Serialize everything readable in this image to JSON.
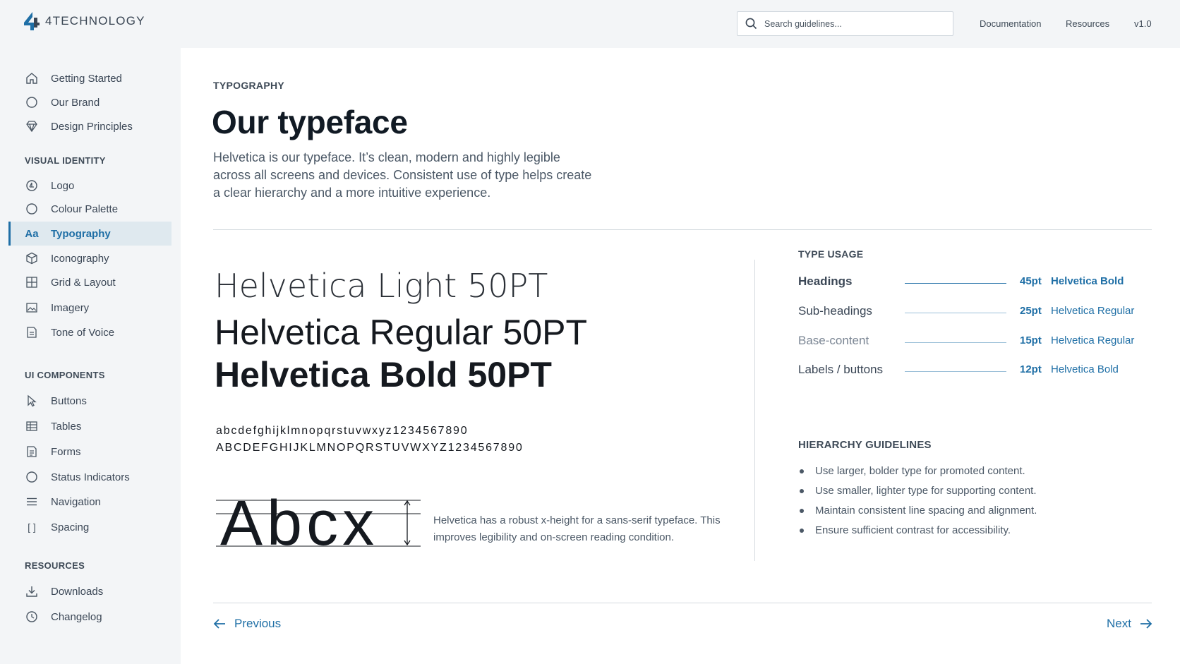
{
  "brand": {
    "name": "4TECHNOLOGY",
    "accent": "#1f6fa6"
  },
  "search": {
    "placeholder": "Search guidelines..."
  },
  "topnav": {
    "documentation": "Documentation",
    "resources": "Resources",
    "version": "v1.0"
  },
  "sidebar": {
    "top_items": [
      {
        "label": "Getting Started",
        "icon": "home-icon"
      },
      {
        "label": "Our Brand",
        "icon": "circle-icon"
      },
      {
        "label": "Design Principles",
        "icon": "diamond-icon"
      }
    ],
    "visual_identity": {
      "heading": "VISUAL IDENTITY",
      "items": [
        {
          "label": "Logo",
          "icon": "logo-icon"
        },
        {
          "label": "Colour Palette",
          "icon": "circle-icon"
        },
        {
          "label": "Typography",
          "icon": "type-aa-icon",
          "icon_text": "Aa",
          "active": true
        },
        {
          "label": "Iconography",
          "icon": "cube-icon"
        },
        {
          "label": "Grid & Layout",
          "icon": "grid-icon"
        },
        {
          "label": "Imagery",
          "icon": "image-icon"
        },
        {
          "label": "Tone of Voice",
          "icon": "document-icon"
        }
      ]
    },
    "ui_components": {
      "heading": "UI COMPONENTS",
      "items": [
        {
          "label": "Buttons",
          "icon": "cursor-icon"
        },
        {
          "label": "Tables",
          "icon": "table-icon"
        },
        {
          "label": "Forms",
          "icon": "form-icon"
        },
        {
          "label": "Status Indicators",
          "icon": "circle-icon"
        },
        {
          "label": "Navigation",
          "icon": "menu-icon"
        },
        {
          "label": "Spacing",
          "icon": "brackets-icon",
          "icon_text": "[ ]"
        }
      ]
    },
    "resources": {
      "heading": "RESOURCES",
      "items": [
        {
          "label": "Downloads",
          "icon": "download-icon"
        },
        {
          "label": "Changelog",
          "icon": "clock-icon"
        }
      ]
    }
  },
  "main": {
    "eyebrow": "TYPOGRAPHY",
    "title": "Our typeface",
    "intro": "Helvetica is our typeface. It’s clean, modern and highly legible across all screens and devices. Consistent use of type helps create a clear hierarchy and a more intuitive experience.",
    "samples": {
      "light": "Helvetica Light 50PT",
      "regular": "Helvetica Regular 50PT",
      "bold": "Helvetica Bold 50PT"
    },
    "lowercase": "abcdefghijklmnopqrstuvwxyz1234567890",
    "uppercase": "ABCDEFGHIJKLMNOPQRSTUVWXYZ1234567890",
    "xheight_sample": "Abcx",
    "xheight_note": "Helvetica has a robust x-height for a sans-serif typeface. This improves legibility and on-screen reading condition.",
    "type_usage": {
      "heading": "TYPE USAGE",
      "rows": [
        {
          "name": "Headings",
          "size": "45pt",
          "font": "Helvetica Bold"
        },
        {
          "name": "Sub-headings",
          "size": "25pt",
          "font": "Helvetica Regular"
        },
        {
          "name": "Base-content",
          "size": "15pt",
          "font": "Helvetica Regular"
        },
        {
          "name": "Labels / buttons",
          "size": "12pt",
          "font": "Helvetica Bold"
        }
      ]
    },
    "hierarchy": {
      "heading": "HIERARCHY GUIDELINES",
      "items": [
        "Use larger, bolder type for promoted content.",
        "Use smaller, lighter type for supporting content.",
        "Maintain consistent line spacing and alignment.",
        "Ensure sufficient contrast for accessibility."
      ]
    },
    "pager": {
      "previous": "Previous",
      "next": "Next"
    }
  }
}
